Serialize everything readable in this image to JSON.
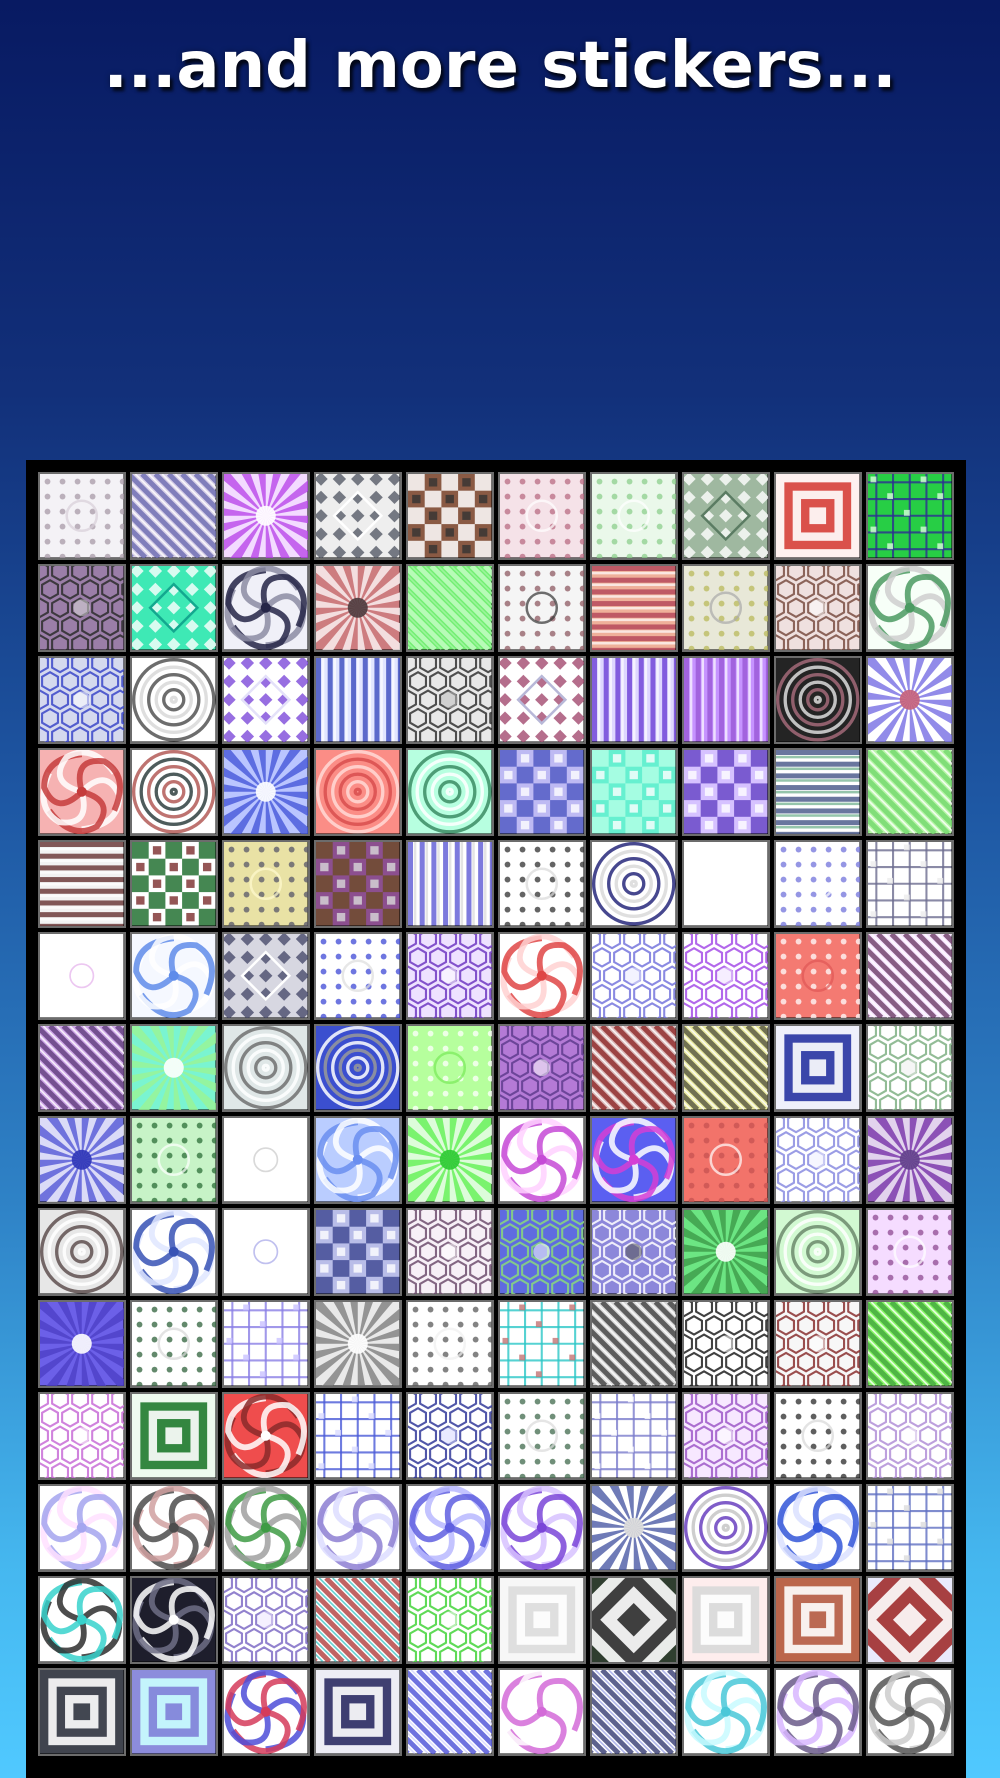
{
  "page": {
    "heading": "...and more stickers..."
  },
  "sticker_grid": {
    "columns": 10,
    "rows": 14,
    "tiles": [
      {
        "pattern": "dots",
        "colors": [
          "#f4f2f6",
          "#a89aa7",
          "#d7cfd8"
        ]
      },
      {
        "pattern": "diagonal",
        "colors": [
          "#d8d0e8",
          "#6b6ab0",
          "#ffffff"
        ]
      },
      {
        "pattern": "radial",
        "colors": [
          "#f3dbff",
          "#b53ee8",
          "#ffffff"
        ]
      },
      {
        "pattern": "diamonds",
        "colors": [
          "#eeeeee",
          "#555a66",
          "#ffffff"
        ]
      },
      {
        "pattern": "checker",
        "colors": [
          "#8a5a44",
          "#ffffff",
          "#333333"
        ]
      },
      {
        "pattern": "dots",
        "colors": [
          "#f5e2e8",
          "#b86b83",
          "#ffffff"
        ]
      },
      {
        "pattern": "dots",
        "colors": [
          "#eaf8ea",
          "#8ccf8c",
          "#ffffff"
        ]
      },
      {
        "pattern": "diamonds",
        "colors": [
          "#9fb8a0",
          "#ffffff",
          "#5b7c63"
        ]
      },
      {
        "pattern": "concentric-squares",
        "colors": [
          "#f66e68",
          "#ffffff",
          "#d63f38"
        ]
      },
      {
        "pattern": "grid",
        "colors": [
          "#27ce45",
          "#2e2e93",
          "#d8ffd9"
        ]
      },
      {
        "pattern": "hex",
        "colors": [
          "#9b7ea8",
          "#2d2d2d",
          "#d8d8d8"
        ]
      },
      {
        "pattern": "diamonds",
        "colors": [
          "#3ee9b5",
          "#ffffff",
          "#13a88f"
        ]
      },
      {
        "pattern": "swirl",
        "colors": [
          "#f0f0f8",
          "#252547",
          "#8c8ca3"
        ]
      },
      {
        "pattern": "radial",
        "colors": [
          "#cd7c7f",
          "#ffffff",
          "#4d3a3d"
        ]
      },
      {
        "pattern": "diagonal",
        "colors": [
          "#72ee72",
          "#c9ffc9",
          "#a4f7a4"
        ]
      },
      {
        "pattern": "dots",
        "colors": [
          "#f5f5f5",
          "#8d5961",
          "#333333"
        ]
      },
      {
        "pattern": "stripes-h",
        "colors": [
          "#efb09a",
          "#b64a5c",
          "#ffffff"
        ]
      },
      {
        "pattern": "dots",
        "colors": [
          "#e8e8d8",
          "#b9b95b",
          "#aaaaaa"
        ]
      },
      {
        "pattern": "hex",
        "colors": [
          "#efe0df",
          "#7a4d43",
          "#ffffff"
        ]
      },
      {
        "pattern": "swirl",
        "colors": [
          "#f7fff8",
          "#4b9a62",
          "#cfcfcf"
        ]
      },
      {
        "pattern": "hex",
        "colors": [
          "#d5d9ee",
          "#3b46c8",
          "#ffffff"
        ]
      },
      {
        "pattern": "concentric",
        "colors": [
          "#ffffff",
          "#545454",
          "#d8d8d8"
        ]
      },
      {
        "pattern": "diamonds",
        "colors": [
          "#ffffff",
          "#7d4ad9",
          "#e4e1f9"
        ]
      },
      {
        "pattern": "stripes-v",
        "colors": [
          "#e1e5ff",
          "#4353c2",
          "#ffffff"
        ]
      },
      {
        "pattern": "hex",
        "colors": [
          "#e8e8e8",
          "#333333",
          "#bdbdbd"
        ]
      },
      {
        "pattern": "diamonds",
        "colors": [
          "#ffffff",
          "#a24a6f",
          "#b8b8d8"
        ]
      },
      {
        "pattern": "stripes-v",
        "colors": [
          "#ded7ff",
          "#7248d8",
          "#ffffff"
        ]
      },
      {
        "pattern": "stripes-v",
        "colors": [
          "#c693ff",
          "#9b5bd8",
          "#ffffff"
        ]
      },
      {
        "pattern": "concentric",
        "colors": [
          "#242424",
          "#a36a79",
          "#dddddd"
        ]
      },
      {
        "pattern": "radial",
        "colors": [
          "#ffffff",
          "#6d64e2",
          "#c55f79"
        ]
      },
      {
        "pattern": "swirl",
        "colors": [
          "#f6b2b2",
          "#c53c3c",
          "#ffffff"
        ]
      },
      {
        "pattern": "concentric",
        "colors": [
          "#ffffff",
          "#b35b57",
          "#2f3f3f"
        ]
      },
      {
        "pattern": "radial",
        "colors": [
          "#bac5ff",
          "#3e4fd7",
          "#ffffff"
        ]
      },
      {
        "pattern": "concentric",
        "colors": [
          "#fb8d86",
          "#ffd9d6",
          "#d84d4d"
        ]
      },
      {
        "pattern": "concentric",
        "colors": [
          "#b7ffe0",
          "#3b8c63",
          "#ffffff"
        ]
      },
      {
        "pattern": "checker",
        "colors": [
          "#bebaf3",
          "#555dc4",
          "#ffffff"
        ]
      },
      {
        "pattern": "checker",
        "colors": [
          "#66f0d0",
          "#b0ffe5",
          "#ffffff"
        ]
      },
      {
        "pattern": "checker",
        "colors": [
          "#d6c2ff",
          "#6a49c8",
          "#ffffff"
        ]
      },
      {
        "pattern": "stripes-h",
        "colors": [
          "#ffffff",
          "#4f5e8d",
          "#68ad87"
        ]
      },
      {
        "pattern": "diagonal",
        "colors": [
          "#b8f5a8",
          "#73d96d",
          "#ffffff"
        ]
      },
      {
        "pattern": "stripes-h",
        "colors": [
          "#f2f2f2",
          "#6d3c3c",
          "#ffffff"
        ]
      },
      {
        "pattern": "checker",
        "colors": [
          "#ffffff",
          "#257234",
          "#7a2c2c"
        ]
      },
      {
        "pattern": "dots",
        "colors": [
          "#e9e2a5",
          "#55556a",
          "#fffbd0"
        ]
      },
      {
        "pattern": "checker",
        "colors": [
          "#8c4f8f",
          "#6f4b2d",
          "#d8d8d8"
        ]
      },
      {
        "pattern": "stripes-v",
        "colors": [
          "#ffffff",
          "#6663d7",
          "#d8d8d8"
        ]
      },
      {
        "pattern": "dots",
        "colors": [
          "#ffffff",
          "#303030",
          "#d9d9d9"
        ]
      },
      {
        "pattern": "concentric",
        "colors": [
          "#ffffff",
          "#27287b",
          "#d9d9d9"
        ]
      },
      {
        "pattern": "plain",
        "colors": [
          "#ffffff",
          "#ffffff",
          "#f2f2f2"
        ]
      },
      {
        "pattern": "dots",
        "colors": [
          "#ffffff",
          "#7173db",
          "#ffffff"
        ]
      },
      {
        "pattern": "grid",
        "colors": [
          "#ffffff",
          "#6e6e90",
          "#ececec"
        ]
      },
      {
        "pattern": "plain",
        "colors": [
          "#ffffff",
          "#c95fd8",
          "#ffffff"
        ]
      },
      {
        "pattern": "swirl",
        "colors": [
          "#f5f8ff",
          "#5f8cea",
          "#ffffff"
        ]
      },
      {
        "pattern": "diamonds",
        "colors": [
          "#d7d7e1",
          "#494b6b",
          "#ffffff"
        ]
      },
      {
        "pattern": "dots",
        "colors": [
          "#ffffff",
          "#3d48d6",
          "#dddddd"
        ]
      },
      {
        "pattern": "hex",
        "colors": [
          "#eee2ff",
          "#6f38c2",
          "#ffffff"
        ]
      },
      {
        "pattern": "swirl",
        "colors": [
          "#ffffff",
          "#df4545",
          "#ffd1d1"
        ]
      },
      {
        "pattern": "hex",
        "colors": [
          "#ffffff",
          "#7675dd",
          "#e9e9ff"
        ]
      },
      {
        "pattern": "hex",
        "colors": [
          "#ffffff",
          "#a54ee7",
          "#efe0ff"
        ]
      },
      {
        "pattern": "dots",
        "colors": [
          "#f47a72",
          "#ffffff",
          "#df5756"
        ]
      },
      {
        "pattern": "diagonal",
        "colors": [
          "#f8e6ff",
          "#6c3b66",
          "#ffffff"
        ]
      },
      {
        "pattern": "diagonal",
        "colors": [
          "#cfa8e8",
          "#5e3b7b",
          "#ffffff"
        ]
      },
      {
        "pattern": "radial",
        "colors": [
          "#7af4d1",
          "#9df48f",
          "#ffffff"
        ]
      },
      {
        "pattern": "concentric",
        "colors": [
          "#dfe7e7",
          "#707070",
          "#ffffff"
        ]
      },
      {
        "pattern": "concentric",
        "colors": [
          "#3b4fcf",
          "#ffffff",
          "#999999"
        ]
      },
      {
        "pattern": "dots",
        "colors": [
          "#b6ff9d",
          "#ffffff",
          "#79ea58"
        ]
      },
      {
        "pattern": "hex",
        "colors": [
          "#b47ad6",
          "#5f3c8e",
          "#ffffff"
        ]
      },
      {
        "pattern": "diagonal",
        "colors": [
          "#dbb9b9",
          "#8d2626",
          "#ffffff"
        ]
      },
      {
        "pattern": "diagonal",
        "colors": [
          "#eaeaa0",
          "#53543f",
          "#ffffff"
        ]
      },
      {
        "pattern": "concentric-squares",
        "colors": [
          "#5f6bcf",
          "#ffffff",
          "#2733a1"
        ]
      },
      {
        "pattern": "hex",
        "colors": [
          "#ffffff",
          "#7fb084",
          "#efefef"
        ]
      },
      {
        "pattern": "radial",
        "colors": [
          "#6f72dd",
          "#ffffff",
          "#2e35b7"
        ]
      },
      {
        "pattern": "dots",
        "colors": [
          "#c7f3c7",
          "#2b6d37",
          "#ffffff"
        ]
      },
      {
        "pattern": "plain",
        "colors": [
          "#ffffff",
          "#929292",
          "#f3f3f3"
        ]
      },
      {
        "pattern": "swirl",
        "colors": [
          "#bacdff",
          "#6a8ef0",
          "#ffffff"
        ]
      },
      {
        "pattern": "radial",
        "colors": [
          "#7af36e",
          "#ffffff",
          "#2cc932"
        ]
      },
      {
        "pattern": "swirl",
        "colors": [
          "#ffffff",
          "#c54ad6",
          "#ffd1ff"
        ]
      },
      {
        "pattern": "swirl",
        "colors": [
          "#5b5ff1",
          "#d53ed5",
          "#ffffff"
        ]
      },
      {
        "pattern": "dots",
        "colors": [
          "#f2736a",
          "#c55252",
          "#ffffff"
        ]
      },
      {
        "pattern": "hex",
        "colors": [
          "#ffffff",
          "#8a8ce0",
          "#efefff"
        ]
      },
      {
        "pattern": "radial",
        "colors": [
          "#8c51b6",
          "#ffffff",
          "#62408b"
        ]
      },
      {
        "pattern": "concentric",
        "colors": [
          "#e7e7e7",
          "#5e4f4f",
          "#ffffff"
        ]
      },
      {
        "pattern": "swirl",
        "colors": [
          "#ffffff",
          "#3752b5",
          "#dfe6ff"
        ]
      },
      {
        "pattern": "plain",
        "colors": [
          "#ffffff",
          "#4a4ad1",
          "#ffffff"
        ]
      },
      {
        "pattern": "checker",
        "colors": [
          "#b9bde8",
          "#434c95",
          "#ffffff"
        ]
      },
      {
        "pattern": "hex",
        "colors": [
          "#f7f0f7",
          "#6f4d6f",
          "#ffffff"
        ]
      },
      {
        "pattern": "hex",
        "colors": [
          "#5f6be0",
          "#8ad97a",
          "#ffffff"
        ]
      },
      {
        "pattern": "hex",
        "colors": [
          "#8c87da",
          "#ffffff",
          "#555555"
        ]
      },
      {
        "pattern": "radial",
        "colors": [
          "#6ce583",
          "#3a9444",
          "#ffffff"
        ]
      },
      {
        "pattern": "concentric",
        "colors": [
          "#d2f9d2",
          "#6c8a6c",
          "#ffffff"
        ]
      },
      {
        "pattern": "dots",
        "colors": [
          "#f5dcff",
          "#8e4a91",
          "#ffffff"
        ]
      },
      {
        "pattern": "radial",
        "colors": [
          "#6c60e8",
          "#4b3ec4",
          "#ffffff"
        ]
      },
      {
        "pattern": "dots",
        "colors": [
          "#ffffff",
          "#2f613b",
          "#d7d7d7"
        ]
      },
      {
        "pattern": "grid",
        "colors": [
          "#ffffff",
          "#8a7fe6",
          "#c9c2ff"
        ]
      },
      {
        "pattern": "radial",
        "colors": [
          "#e9e9e9",
          "#777777",
          "#ffffff"
        ]
      },
      {
        "pattern": "dots",
        "colors": [
          "#ffffff",
          "#595959",
          "#f0f0f0"
        ]
      },
      {
        "pattern": "grid",
        "colors": [
          "#ffffff",
          "#2cc7c7",
          "#c47373"
        ]
      },
      {
        "pattern": "diagonal",
        "colors": [
          "#d8d8d8",
          "#3f3f3f",
          "#ffffff"
        ]
      },
      {
        "pattern": "hex",
        "colors": [
          "#ffffff",
          "#202020",
          "#ffffff"
        ]
      },
      {
        "pattern": "hex",
        "colors": [
          "#f7f7f7",
          "#8a3030",
          "#ffffff"
        ]
      },
      {
        "pattern": "diagonal",
        "colors": [
          "#88f567",
          "#42a63d",
          "#ffffff"
        ]
      },
      {
        "pattern": "hex",
        "colors": [
          "#ffffff",
          "#c86cd7",
          "#ffffff"
        ]
      },
      {
        "pattern": "concentric-squares",
        "colors": [
          "#54c85a",
          "#ffffff",
          "#1f7a2d"
        ]
      },
      {
        "pattern": "swirl",
        "colors": [
          "#ef4d4d",
          "#ffffff",
          "#8a2a2a"
        ]
      },
      {
        "pattern": "grid",
        "colors": [
          "#ffffff",
          "#4b5bd8",
          "#d9dbff"
        ]
      },
      {
        "pattern": "hex",
        "colors": [
          "#ffffff",
          "#32399a",
          "#d7d9ff"
        ]
      },
      {
        "pattern": "dots",
        "colors": [
          "#ffffff",
          "#40694c",
          "#dadada"
        ]
      },
      {
        "pattern": "grid",
        "colors": [
          "#ffffff",
          "#7b7dcc",
          "#ffffff"
        ]
      },
      {
        "pattern": "hex",
        "colors": [
          "#f7e8ff",
          "#9e58c8",
          "#ffffff"
        ]
      },
      {
        "pattern": "dots",
        "colors": [
          "#ffffff",
          "#2a2a2a",
          "#d7d7d7"
        ]
      },
      {
        "pattern": "hex",
        "colors": [
          "#ffffff",
          "#b28fd7",
          "#ffffff"
        ]
      },
      {
        "pattern": "swirl",
        "colors": [
          "#ffffff",
          "#a5a5ef",
          "#ffe0ff"
        ]
      },
      {
        "pattern": "swirl",
        "colors": [
          "#ffffff",
          "#4c4c4c",
          "#d0a0a0"
        ]
      },
      {
        "pattern": "swirl",
        "colors": [
          "#ffffff",
          "#3e9b44",
          "#a0a0a0"
        ]
      },
      {
        "pattern": "swirl",
        "colors": [
          "#ffffff",
          "#8d7fd2",
          "#ddddff"
        ]
      },
      {
        "pattern": "swirl",
        "colors": [
          "#ffffff",
          "#5f5fe0",
          "#b8b8ff"
        ]
      },
      {
        "pattern": "swirl",
        "colors": [
          "#ffffff",
          "#7a45d8",
          "#d7c2ff"
        ]
      },
      {
        "pattern": "radial",
        "colors": [
          "#ffffff",
          "#3f4f9f",
          "#dadada"
        ]
      },
      {
        "pattern": "concentric",
        "colors": [
          "#ffffff",
          "#6a41bf",
          "#c5c5c5"
        ]
      },
      {
        "pattern": "swirl",
        "colors": [
          "#ffffff",
          "#3356d8",
          "#dae1ff"
        ]
      },
      {
        "pattern": "grid",
        "colors": [
          "#ffffff",
          "#6070c3",
          "#dcdcdc"
        ]
      },
      {
        "pattern": "swirl",
        "colors": [
          "#ffffff",
          "#37d2cc",
          "#2e2e2e"
        ]
      },
      {
        "pattern": "swirl",
        "colors": [
          "#1e1e2c",
          "#ffffff",
          "#6f6f86"
        ]
      },
      {
        "pattern": "hex",
        "colors": [
          "#ffffff",
          "#7f6cc6",
          "#ece6ff"
        ]
      },
      {
        "pattern": "diagonal",
        "colors": [
          "#ffffff",
          "#b23d3d",
          "#43c8c8"
        ]
      },
      {
        "pattern": "hex",
        "colors": [
          "#ffffff",
          "#43d43a",
          "#ffffff"
        ]
      },
      {
        "pattern": "concentric-squares",
        "colors": [
          "#a8a8a8",
          "#ffffff",
          "#dcdcdc"
        ]
      },
      {
        "pattern": "concentric-squares",
        "colors": [
          "#45e245",
          "#2c2c2c",
          "#ffffff"
        ]
      },
      {
        "pattern": "concentric-squares",
        "colors": [
          "#ef4d4d",
          "#ffffff",
          "#d8d8d8"
        ]
      },
      {
        "pattern": "concentric-squares",
        "colors": [
          "#ffd7a6",
          "#b45a41",
          "#ffffff"
        ]
      },
      {
        "pattern": "concentric-squares",
        "colors": [
          "#2f2fdc",
          "#ffffff",
          "#a02d2d"
        ]
      },
      {
        "pattern": "concentric-squares",
        "colors": [
          "#d8d8d8",
          "#30343f",
          "#ffffff"
        ]
      },
      {
        "pattern": "concentric-squares",
        "colors": [
          "#ffffff",
          "#7f7fd8",
          "#caffff"
        ]
      },
      {
        "pattern": "swirl",
        "colors": [
          "#ffffff",
          "#d53b5a",
          "#4d4dd8"
        ]
      },
      {
        "pattern": "concentric-squares",
        "colors": [
          "#4b4b9b",
          "#ffffff",
          "#2b2b63"
        ]
      },
      {
        "pattern": "diagonal",
        "colors": [
          "#ffffff",
          "#4b4fd8",
          "#d6d6ff"
        ]
      },
      {
        "pattern": "swirl",
        "colors": [
          "#ffffff",
          "#d36bd8",
          "#ffffff"
        ]
      },
      {
        "pattern": "diagonal",
        "colors": [
          "#ffffff",
          "#353b73",
          "#9fa7e8"
        ]
      },
      {
        "pattern": "swirl",
        "colors": [
          "#ffffff",
          "#4ac8d8",
          "#c8faff"
        ]
      },
      {
        "pattern": "swirl",
        "colors": [
          "#ffffff",
          "#6a5a8a",
          "#d8b6ff"
        ]
      },
      {
        "pattern": "swirl",
        "colors": [
          "#ffffff",
          "#555555",
          "#cdcdcd"
        ]
      }
    ]
  }
}
